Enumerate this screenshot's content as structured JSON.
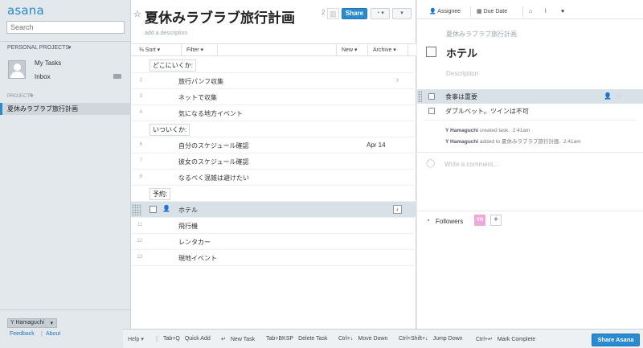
{
  "sidebar": {
    "logo": "asana",
    "search_placeholder": "Search",
    "personal_projects_label": "PERSONAL PROJECTS",
    "my_tasks": "My Tasks",
    "inbox": "Inbox",
    "projects_label": "PROJECTS",
    "project_name": "夏休みラブラブ旅行計画",
    "user_name": "Y Hamaguchi",
    "feedback": "Feedback",
    "about": "About"
  },
  "project": {
    "title": "夏休みラブラブ旅行計画",
    "member_count": "2",
    "share_label": "Share",
    "description_placeholder": "add a description",
    "toolbar": {
      "sort": "Sort",
      "filter": "Filter",
      "new": "New",
      "archive": "Archive"
    }
  },
  "tasks": [
    {
      "num": "",
      "title": "どこにいくか:",
      "section": true
    },
    {
      "num": "2",
      "title": "旅行パンフ収集",
      "arrow": true
    },
    {
      "num": "3",
      "title": "ネットで収集"
    },
    {
      "num": "4",
      "title": "気になる地方イベント"
    },
    {
      "num": "",
      "title": "いついくか:",
      "section": true
    },
    {
      "num": "6",
      "title": "自分のスケジュール確認",
      "due": "Apr 14"
    },
    {
      "num": "7",
      "title": "彼女のスケジュール確認"
    },
    {
      "num": "8",
      "title": "なるべく混雑は避けたい"
    },
    {
      "num": "",
      "title": "予約:",
      "section": true
    },
    {
      "num": "",
      "title": "ホテル",
      "selected": true
    },
    {
      "num": "11",
      "title": "飛行機"
    },
    {
      "num": "12",
      "title": "レンタカー"
    },
    {
      "num": "13",
      "title": "現地イベント"
    }
  ],
  "detail": {
    "toolbar": {
      "assignee": "Assignee",
      "due_date": "Due Date"
    },
    "project_name": "夏休みラブラブ旅行計画",
    "task_title": "ホテル",
    "description_placeholder": "Description",
    "subtasks": [
      {
        "title": "食事は重要",
        "highlight": true
      },
      {
        "title": "ダブルベット。ツインは不可",
        "highlight": false
      }
    ],
    "activity": [
      {
        "user": "Y Hamaguchi",
        "text": "created task.",
        "time": "2:41am"
      },
      {
        "user": "Y Hamaguchi",
        "text": "added to 夏休みラブラブ旅行計画.",
        "time": "2:41am"
      }
    ],
    "comment_placeholder": "Write a comment...",
    "followers_label": "Followers",
    "follower_initials": "YH"
  },
  "shortcuts": {
    "help": "Help",
    "items": [
      {
        "keys": "Tab+Q",
        "action": "Quick Add"
      },
      {
        "keys": "↵",
        "action": "New Task"
      },
      {
        "keys": "Tab+BKSP",
        "action": "Delete Task"
      },
      {
        "keys": "Ctrl+↓",
        "action": "Move Down"
      },
      {
        "keys": "Ctrl+Shift+↓",
        "action": "Jump Down"
      },
      {
        "keys": "Ctrl+↵",
        "action": "Mark Complete"
      }
    ],
    "share_asana": "Share Asana"
  },
  "colors": {
    "accent": "#2a8bd0",
    "selected_row": "#d9e1e8",
    "follower_avatar": "#f0a8d8"
  }
}
